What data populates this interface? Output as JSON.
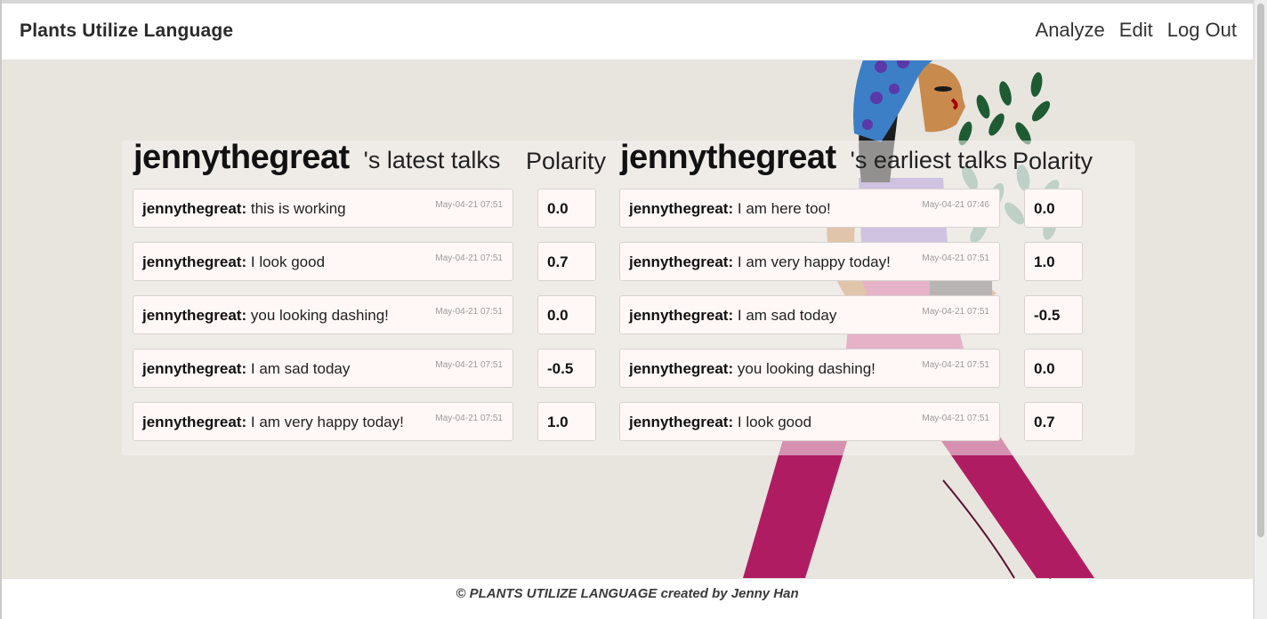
{
  "navbar": {
    "brand": "Plants Utilize Language",
    "links": [
      "Analyze",
      "Edit",
      "Log Out"
    ]
  },
  "latest": {
    "username": "jennythegreat",
    "suffix": "'s latest talks",
    "polarity_label": "Polarity",
    "talks": [
      {
        "user": "jennythegreat:",
        "text": "this is working",
        "time": "May-04-21 07:51",
        "polarity": "0.0"
      },
      {
        "user": "jennythegreat:",
        "text": "I look good",
        "time": "May-04-21 07:51",
        "polarity": "0.7"
      },
      {
        "user": "jennythegreat:",
        "text": "you looking dashing!",
        "time": "May-04-21 07:51",
        "polarity": "0.0"
      },
      {
        "user": "jennythegreat:",
        "text": "I am sad today",
        "time": "May-04-21 07:51",
        "polarity": "-0.5"
      },
      {
        "user": "jennythegreat:",
        "text": "I am very happy today!",
        "time": "May-04-21 07:51",
        "polarity": "1.0"
      }
    ]
  },
  "earliest": {
    "username": "jennythegreat",
    "suffix": "'s earliest talks",
    "polarity_label": "Polarity",
    "talks": [
      {
        "user": "jennythegreat:",
        "text": "I am here too!",
        "time": "May-04-21 07:46",
        "polarity": "0.0"
      },
      {
        "user": "jennythegreat:",
        "text": "I am very happy today!",
        "time": "May-04-21 07:51",
        "polarity": "1.0"
      },
      {
        "user": "jennythegreat:",
        "text": "I am sad today",
        "time": "May-04-21 07:51",
        "polarity": "-0.5"
      },
      {
        "user": "jennythegreat:",
        "text": "you looking dashing!",
        "time": "May-04-21 07:51",
        "polarity": "0.0"
      },
      {
        "user": "jennythegreat:",
        "text": "I look good",
        "time": "May-04-21 07:51",
        "polarity": "0.7"
      }
    ]
  },
  "footer": {
    "text": "© PLANTS UTILIZE LANGUAGE created by Jenny Han"
  },
  "colors": {
    "background": "#e8e5df",
    "pants": "#b01c62",
    "scarf": "#3c7fc7",
    "leaves": "#1e5b33"
  }
}
